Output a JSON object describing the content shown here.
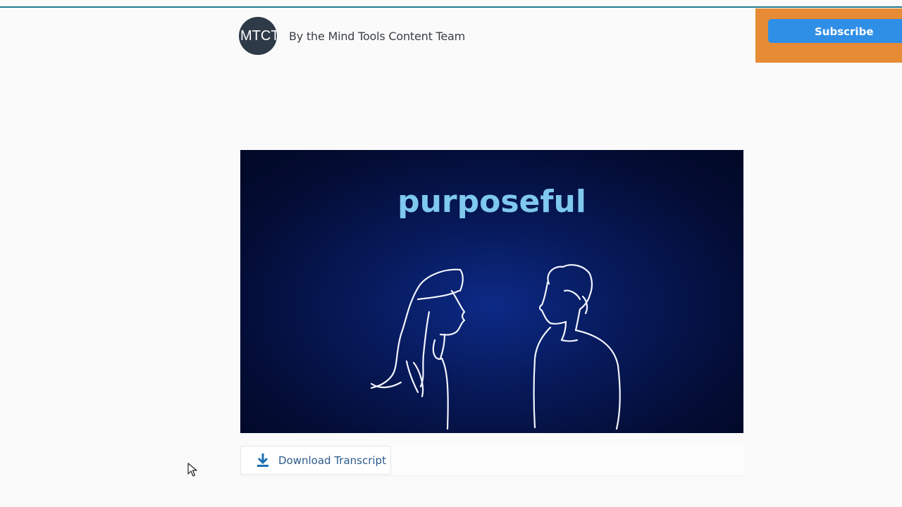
{
  "header": {
    "author_avatar_text": "MTCT",
    "author_byline": "By the Mind Tools Content Team"
  },
  "subscribe": {
    "label": "Subscribe"
  },
  "video": {
    "overlay_word": "purposeful"
  },
  "transcript": {
    "download_label": "Download Transcript"
  },
  "colors": {
    "top_rule": "#1f7a8c",
    "subscribe_panel": "#e78b34",
    "subscribe_button": "#2f8ee6",
    "video_background": "#071a5c",
    "overlay_word": "#7fc8ee",
    "link_text": "#2c5a8c"
  },
  "icons": {
    "download": "download-icon",
    "cursor": "mouse-pointer-icon"
  }
}
